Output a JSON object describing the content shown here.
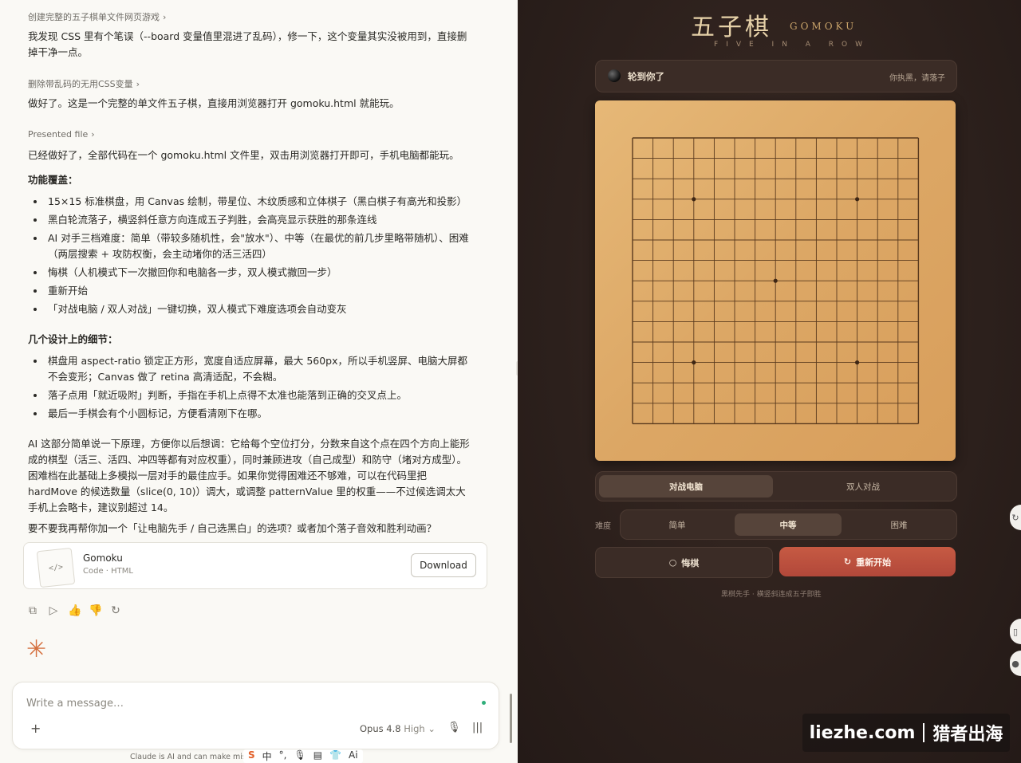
{
  "chat": {
    "step1": "创建完整的五子棋单文件网页游戏",
    "msg1": "我发现 CSS 里有个笔误（--board 变量值里混进了乱码），修一下，这个变量其实没被用到，直接删掉干净一点。",
    "step2": "删除带乱码的无用CSS变量",
    "msg2": "做好了。这是一个完整的单文件五子棋，直接用浏览器打开 gomoku.html 就能玩。",
    "step3": "Presented file",
    "msg3": "已经做好了，全部代码在一个 gomoku.html 文件里，双击用浏览器打开即可，手机电脑都能玩。",
    "features_heading": "功能覆盖：",
    "features": [
      "15×15 标准棋盘，用 Canvas 绘制，带星位、木纹质感和立体棋子（黑白棋子有高光和投影）",
      "黑白轮流落子，横竖斜任意方向连成五子判胜，会高亮显示获胜的那条连线",
      "AI 对手三档难度：简单（带较多随机性，会\"放水\"）、中等（在最优的前几步里略带随机）、困难（两层搜索 + 攻防权衡，会主动堵你的活三活四）",
      "悔棋（人机模式下一次撤回你和电脑各一步，双人模式撤回一步）",
      "重新开始",
      "「对战电脑 / 双人对战」一键切换，双人模式下难度选项会自动变灰"
    ],
    "details_heading": "几个设计上的细节：",
    "details": [
      "棋盘用 aspect-ratio 锁定正方形，宽度自适应屏幕，最大 560px，所以手机竖屏、电脑大屏都不会变形；Canvas 做了 retina 高清适配，不会糊。",
      "落子点用「就近吸附」判断，手指在手机上点得不太准也能落到正确的交叉点上。",
      "最后一手棋会有个小圆标记，方便看清刚下在哪。"
    ],
    "ai_para": "AI 这部分简单说一下原理，方便你以后想调：它给每个空位打分，分数来自这个点在四个方向上能形成的棋型（活三、活四、冲四等都有对应权重），同时兼顾进攻（自己成型）和防守（堵对方成型）。困难档在此基础上多模拟一层对手的最佳应手。如果你觉得困难还不够难，可以在代码里把 hardMove 的候选数量（slice(0, 10)）调大，或调整 patternValue 里的权重——不过候选调太大手机上会略卡，建议别超过 14。",
    "followup": "要不要我再帮你加一个「让电脑先手 / 自己选黑白」的选项？或者加个落子音效和胜利动画？",
    "file_name": "Gomoku",
    "file_meta": "Code · HTML",
    "download": "Download",
    "input_placeholder": "Write a message…",
    "model": "Opus 4.8",
    "effort": "High",
    "disclaimer": "Claude is AI and can make mist",
    "ime": [
      "中",
      "°,",
      "🎙",
      "▤",
      "👕",
      "Ai"
    ]
  },
  "game": {
    "title": "五子棋",
    "title_en": "GOMOKU",
    "tagline": "FIVE IN A ROW",
    "status": "轮到你了",
    "status_right": "你执黑，请落子",
    "board_size": 15,
    "star_points": [
      [
        3,
        3
      ],
      [
        3,
        11
      ],
      [
        7,
        7
      ],
      [
        11,
        3
      ],
      [
        11,
        11
      ]
    ],
    "modes": [
      "对战电脑",
      "双人对战"
    ],
    "active_mode": 0,
    "difficulty_label": "难度",
    "difficulties": [
      "简单",
      "中等",
      "困难"
    ],
    "active_difficulty": 1,
    "undo": "悔棋",
    "restart": "重新开始",
    "hint": "黑棋先手 · 横竖斜连成五子即胜"
  },
  "watermark": {
    "left": "liezhe.com",
    "right": "猎者出海"
  },
  "colors": {
    "accent": "#c65a43",
    "board": "#dca765",
    "bg": "#2c201c"
  }
}
